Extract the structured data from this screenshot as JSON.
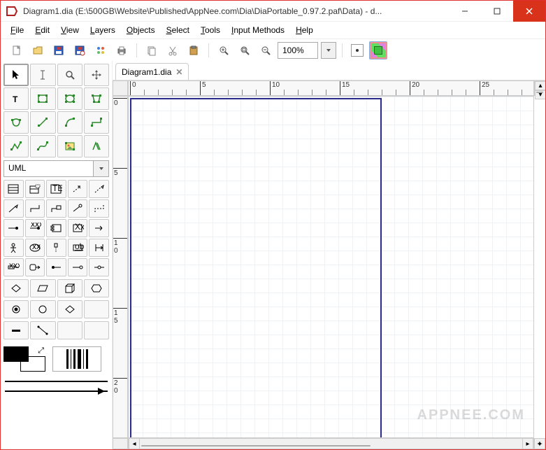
{
  "window": {
    "title": "Diagram1.dia (E:\\500GB\\Website\\Published\\AppNee.com\\Dia\\DiaPortable_0.97.2.paf\\Data) - d..."
  },
  "menu": {
    "file": "File",
    "edit": "Edit",
    "view": "View",
    "layers": "Layers",
    "objects": "Objects",
    "select": "Select",
    "tools": "Tools",
    "input_methods": "Input Methods",
    "help": "Help"
  },
  "toolbar": {
    "zoom_value": "100%"
  },
  "toolbox": {
    "category": "UML"
  },
  "tabs": {
    "tab1": "Diagram1.dia"
  },
  "ruler": {
    "h_labels": [
      "0",
      "5",
      "10",
      "15",
      "20",
      "25"
    ],
    "v_labels": [
      "0",
      "5",
      "1\n0",
      "1\n5",
      "2\n0"
    ]
  },
  "watermark": "APPNEE.COM"
}
